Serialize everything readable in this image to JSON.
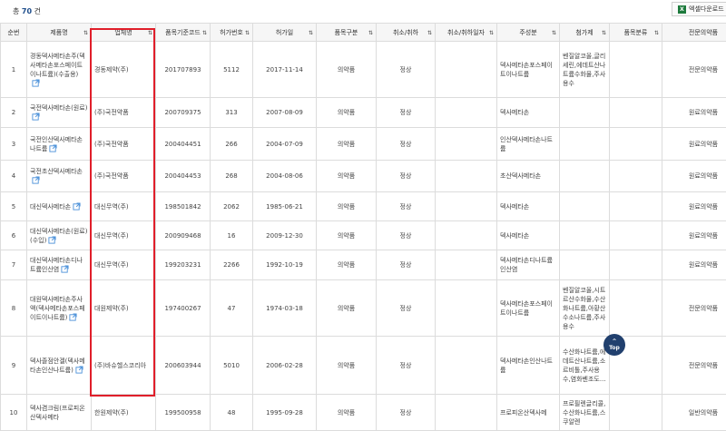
{
  "summary": {
    "prefix": "총",
    "count": "70",
    "suffix": "건"
  },
  "toolbar": {
    "excel_label": "엑셀다운로드"
  },
  "columns": [
    "순번",
    "제품명",
    "업체명",
    "품목기준코드",
    "허가번호",
    "허가일",
    "품목구분",
    "취소/취하",
    "취소/취하일자",
    "주성분",
    "첨가제",
    "품목분류",
    "전문의약품"
  ],
  "rows": [
    {
      "no": "1",
      "product": "경동덱사메타손주(덱사메타손포스페이트이나트륨)(수출용)",
      "company": "경동제약(주)",
      "code": "201707893",
      "permit": "5112",
      "date": "2017-11-14",
      "type": "의약품",
      "cancel": "정상",
      "cancel_date": "",
      "ingredient": "덱사메타손포스페이트이나트륨",
      "additive": "벤질알코올,글리세린,에데트산나트륨수화물,주사용수",
      "class": "",
      "etc": "전문의약품"
    },
    {
      "no": "2",
      "product": "국전덱사메타손(원료)",
      "company": "(주)국전약품",
      "code": "200709375",
      "permit": "313",
      "date": "2007-08-09",
      "type": "의약품",
      "cancel": "정상",
      "cancel_date": "",
      "ingredient": "덱사메타손",
      "additive": "",
      "class": "",
      "etc": "원료의약품"
    },
    {
      "no": "3",
      "product": "국전인산덱사메타손나트륨",
      "company": "(주)국전약품",
      "code": "200404451",
      "permit": "266",
      "date": "2004-07-09",
      "type": "의약품",
      "cancel": "정상",
      "cancel_date": "",
      "ingredient": "인산덱사메타손나트륨",
      "additive": "",
      "class": "",
      "etc": "원료의약품"
    },
    {
      "no": "4",
      "product": "국전초산덱사메타손",
      "company": "(주)국전약품",
      "code": "200404453",
      "permit": "268",
      "date": "2004-08-06",
      "type": "의약품",
      "cancel": "정상",
      "cancel_date": "",
      "ingredient": "초산덱사메타손",
      "additive": "",
      "class": "",
      "etc": "원료의약품"
    },
    {
      "no": "5",
      "product": "대신덱사메타손",
      "company": "대신무역(주)",
      "code": "198501842",
      "permit": "2062",
      "date": "1985-06-21",
      "type": "의약품",
      "cancel": "정상",
      "cancel_date": "",
      "ingredient": "덱사메타손",
      "additive": "",
      "class": "",
      "etc": "원료의약품"
    },
    {
      "no": "6",
      "product": "대신덱사메타손(원료)(수입)",
      "company": "대신무역(주)",
      "code": "200909468",
      "permit": "16",
      "date": "2009-12-30",
      "type": "의약품",
      "cancel": "정상",
      "cancel_date": "",
      "ingredient": "덱사메타손",
      "additive": "",
      "class": "",
      "etc": "원료의약품"
    },
    {
      "no": "7",
      "product": "대신덱사메타손디나트륨인산염",
      "company": "대신무역(주)",
      "code": "199203231",
      "permit": "2266",
      "date": "1992-10-19",
      "type": "의약품",
      "cancel": "정상",
      "cancel_date": "",
      "ingredient": "덱사메타손디나트륨인산염",
      "additive": "",
      "class": "",
      "etc": "원료의약품"
    },
    {
      "no": "8",
      "product": "대원덱사메타손주사액(덱사메타손포스페이트이나트륨)",
      "company": "대원제약(주)",
      "code": "197400267",
      "permit": "47",
      "date": "1974-03-18",
      "type": "의약품",
      "cancel": "정상",
      "cancel_date": "",
      "ingredient": "덱사메타손포스페이트이나트륨",
      "additive": "벤질알코올,시트르산수화물,수산화나트륨,아황산수소나트륨,주사용수",
      "class": "",
      "etc": "전문의약품"
    },
    {
      "no": "9",
      "product": "덱사졸점안겔(덱사메타손인산나트륨)",
      "company": "(주)바슈헬스코리아",
      "code": "200603944",
      "permit": "5010",
      "date": "2006-02-28",
      "type": "의약품",
      "cancel": "정상",
      "cancel_date": "",
      "ingredient": "덱사메타손인산나트륨",
      "additive": "수산화나트륨,에데트산나트륨,소르비톨,주사용수,염화벤조도...",
      "class": "",
      "etc": "전문의약품"
    },
    {
      "no": "10",
      "product": "덱사겸크림(프로피온산덱사메타",
      "company": "한원제약(주)",
      "code": "199500958",
      "permit": "48",
      "date": "1995-09-28",
      "type": "의약품",
      "cancel": "정상",
      "cancel_date": "",
      "ingredient": "프로피온산덱사메",
      "additive": "프로필렌글리콜,수산화나트륨,스쿠알렌",
      "class": "",
      "etc": "일반의약품"
    }
  ],
  "top_button": {
    "arrow": "^",
    "label": "Top"
  }
}
